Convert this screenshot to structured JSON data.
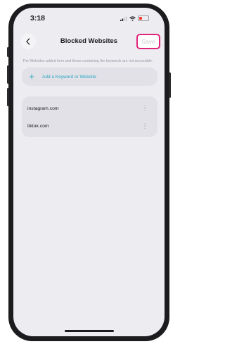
{
  "status_bar": {
    "time": "3:18"
  },
  "header": {
    "title": "Blocked Websites",
    "save_label": "Save"
  },
  "description": "The Websites added here and those containing the keywords are not accessible.",
  "add_row": {
    "label": "Add a Keyword or Website"
  },
  "blocked_sites": [
    "instagram.com",
    "tiktok.com"
  ],
  "colors": {
    "accent": "#2aa7c4",
    "highlight": "#e0247a",
    "battery_low": "#ff3b30"
  }
}
